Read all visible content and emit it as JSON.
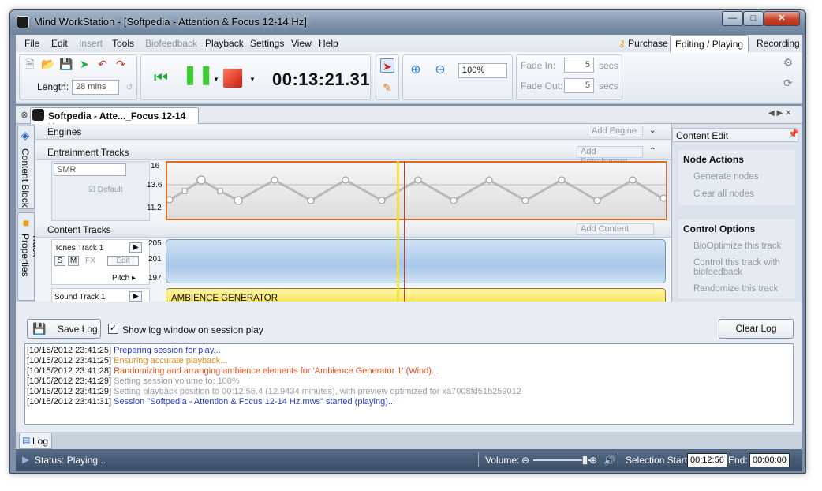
{
  "window": {
    "title": "Mind WorkStation - [Softpedia - Attention & Focus 12-14 Hz]"
  },
  "menu": {
    "items": [
      "File",
      "Edit",
      "Insert",
      "Tools",
      "Biofeedback",
      "Playback",
      "Settings",
      "View",
      "Help"
    ],
    "purchase": "Purchase",
    "tab_editing": "Editing / Playing",
    "tab_recording": "Recording"
  },
  "toolbar": {
    "length_label": "Length:",
    "length_value": "28 mins",
    "timer": "00:13:21.31",
    "zoom": "100%",
    "fade_in_label": "Fade In:",
    "fade_in_value": "5",
    "fade_out_label": "Fade Out:",
    "fade_out_value": "5",
    "secs": "secs"
  },
  "doc_tab": {
    "label": "Softpedia - Atte..._Focus 12-14 Hz"
  },
  "side_tabs": {
    "content_block": "Content Block",
    "track_properties": "Track Properties"
  },
  "editor": {
    "engines": "Engines",
    "add_engine": "Add Engine",
    "entrainment_tracks": "Entrainment Tracks",
    "add_entrainment": "Add Entrainment",
    "smr": "SMR",
    "default_label": "Default",
    "y_ticks": [
      "16",
      "13.6",
      "11.2"
    ],
    "content_tracks": "Content Tracks",
    "add_content": "Add Content",
    "tones_track": "Tones Track 1",
    "fx": "FX",
    "edit": "Edit",
    "pitch": "Pitch",
    "tone_ticks": [
      "205",
      "201",
      "197"
    ],
    "sound_track": "Sound Track 1",
    "ambience": "AMBIENCE GENERATOR",
    "s": "S",
    "m": "M"
  },
  "right_panel": {
    "title": "Content Edit",
    "node_actions": "Node Actions",
    "generate_nodes": "Generate nodes",
    "clear_all_nodes": "Clear all nodes",
    "control_options": "Control Options",
    "bio_optimize": "BioOptimize this track",
    "control_track": "Control this track with",
    "control_track_2": "biofeedback",
    "randomize": "Randomize this track"
  },
  "log": {
    "save_log": "Save Log",
    "show_log": "Show log window on session play",
    "clear_log": "Clear Log",
    "lines": [
      {
        "ts": "[10/15/2012 23:41:25]",
        "msg": "Preparing session for play...",
        "color": "#2a3ec8"
      },
      {
        "ts": "[10/15/2012 23:41:25]",
        "msg": "Ensuring accurate playback...",
        "color": "#e08a1e"
      },
      {
        "ts": "[10/15/2012 23:41:28]",
        "msg": "Randomizing and arranging ambience elements for 'Ambience Generator 1' (Wind)...",
        "color": "#e0501e"
      },
      {
        "ts": "[10/15/2012 23:41:29]",
        "msg": "Setting session volume to: 100%",
        "color": "#9aa0a8"
      },
      {
        "ts": "[10/15/2012 23:41:29]",
        "msg": "Setting playback position to 00:12:56.4 (12.9434 minutes), with preview optimized for xa7008fd51b259012",
        "color": "#9aa0a8"
      },
      {
        "ts": "[10/15/2012 23:41:31]",
        "msg": "Session \"Softpedia - Attention & Focus 12-14 Hz.mws\" started (playing)...",
        "color": "#2a3ec8"
      }
    ],
    "tab": "Log"
  },
  "status": {
    "text": "Status: Playing...",
    "volume_label": "Volume:",
    "selection_start_label": "Selection Start:",
    "selection_start": "00:12:56",
    "end_label": "End:",
    "end": "00:00:00"
  }
}
